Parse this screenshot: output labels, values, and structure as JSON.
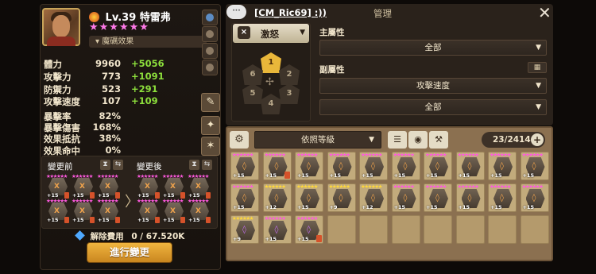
{
  "hero": {
    "level_label": "Lv.39",
    "name": "特雷弗",
    "stars": "★★★★★★",
    "effect_label": "魔礪效果"
  },
  "stats": [
    {
      "label": "體力",
      "value": "9960",
      "bonus": "+5056"
    },
    {
      "label": "攻擊力",
      "value": "773",
      "bonus": "+1091"
    },
    {
      "label": "防禦力",
      "value": "523",
      "bonus": "+291"
    },
    {
      "label": "攻擊速度",
      "value": "107",
      "bonus": "+109"
    },
    {
      "label": "暴擊率",
      "value": "82%",
      "bonus": ""
    },
    {
      "label": "暴擊傷害",
      "value": "168%",
      "bonus": ""
    },
    {
      "label": "效果抵抗",
      "value": "38%",
      "bonus": ""
    },
    {
      "label": "效果命中",
      "value": "0%",
      "bonus": ""
    }
  ],
  "change": {
    "before_label": "變更前",
    "after_label": "變更後",
    "hourglass": "⧗",
    "swap": "⇆",
    "arrow": "〉",
    "cost_label": "解除費用",
    "cost_value": "0 / 67.520K",
    "execute_label": "進行變更",
    "before_runes": [
      {
        "stars": "★★★★★★",
        "level": "+15",
        "glyph": "X",
        "star_color": "#ff5adf"
      },
      {
        "stars": "★★★★★★",
        "level": "+15",
        "glyph": "X",
        "star_color": "#ff5adf"
      },
      {
        "stars": "★★★★★★",
        "level": "+15",
        "glyph": "X",
        "star_color": "#ff5adf"
      },
      {
        "stars": "★★★★★★",
        "level": "+15",
        "glyph": "X",
        "star_color": "#ff5adf"
      },
      {
        "stars": "★★★★★★",
        "level": "+15",
        "glyph": "X",
        "star_color": "#ff5adf"
      },
      {
        "stars": "★★★★★★",
        "level": "+15",
        "glyph": "X",
        "star_color": "#ff5adf"
      }
    ],
    "after_runes": [
      {
        "stars": "★★★★★★",
        "level": "+15",
        "glyph": "X",
        "star_color": "#ff5adf"
      },
      {
        "stars": "★★★★★★",
        "level": "+15",
        "glyph": "X",
        "star_color": "#ff5adf"
      },
      {
        "stars": "★★★★★★",
        "level": "+15",
        "glyph": "X",
        "star_color": "#ff5adf"
      },
      {
        "stars": "★★★★★★",
        "level": "+15",
        "glyph": "X",
        "star_color": "#ff5adf"
      },
      {
        "stars": "★★★★★★",
        "level": "+15",
        "glyph": "X",
        "star_color": "#ff5adf"
      },
      {
        "stars": "★★★★★★",
        "level": "+15",
        "glyph": "X",
        "star_color": "#ff5adf"
      }
    ]
  },
  "manage": {
    "chat_label": "···",
    "username": "[CM_Ric69] :))",
    "title": "管理",
    "close": "✕",
    "rune_set": "激怒",
    "slots": [
      "1",
      "2",
      "3",
      "4",
      "5",
      "6"
    ],
    "main_attr_label": "主屬性",
    "main_attr_value": "全部",
    "sub_attr_label": "副屬性",
    "sub_attr_value": "攻擊速度",
    "sub_attr_value2": "全部",
    "dropdown_arrow": "▼"
  },
  "inventory": {
    "sort_label": "依照等級",
    "count": "23/2414",
    "plus": "+",
    "gear": "⚙",
    "runes": [
      {
        "stars": "★★★★★★",
        "level": "+15",
        "glyph": "◊",
        "star_color": "#ff5adf",
        "glyph_color": "#f0a34c",
        "mono": false
      },
      {
        "stars": "★★★★★★",
        "level": "+15",
        "glyph": "◊",
        "star_color": "#ff5adf",
        "glyph_color": "#f0a34c",
        "mono": true
      },
      {
        "stars": "★★★★★★",
        "level": "+15",
        "glyph": "◊",
        "star_color": "#ff5adf",
        "glyph_color": "#f0a34c",
        "mono": false
      },
      {
        "stars": "★★★★★★",
        "level": "+15",
        "glyph": "◊",
        "star_color": "#ff5adf",
        "glyph_color": "#f0a34c",
        "mono": false
      },
      {
        "stars": "★★★★★★",
        "level": "+15",
        "glyph": "◊",
        "star_color": "#ff5adf",
        "glyph_color": "#f0a34c",
        "mono": false
      },
      {
        "stars": "★★★★★★",
        "level": "+15",
        "glyph": "◊",
        "star_color": "#ff5adf",
        "glyph_color": "#f0a34c",
        "mono": false
      },
      {
        "stars": "★★★★★★",
        "level": "+15",
        "glyph": "◊",
        "star_color": "#ff5adf",
        "glyph_color": "#f0a34c",
        "mono": false
      },
      {
        "stars": "★★★★★★",
        "level": "+15",
        "glyph": "◊",
        "star_color": "#ff5adf",
        "glyph_color": "#f0a34c",
        "mono": false
      },
      {
        "stars": "★★★★★★",
        "level": "+15",
        "glyph": "◊",
        "star_color": "#ff5adf",
        "glyph_color": "#f0a34c",
        "mono": false
      },
      {
        "stars": "★★★★★★",
        "level": "+15",
        "glyph": "◊",
        "star_color": "#ff5adf",
        "glyph_color": "#f0a34c",
        "mono": false
      },
      {
        "stars": "★★★★★★",
        "level": "+15",
        "glyph": "◊",
        "star_color": "#ff5adf",
        "glyph_color": "#f0a34c",
        "mono": false
      },
      {
        "stars": "★★★★★★",
        "level": "+12",
        "glyph": "◊",
        "star_color": "#ffd83a",
        "glyph_color": "#f0a34c",
        "mono": false
      },
      {
        "stars": "★★★★★★",
        "level": "+15",
        "glyph": "◊",
        "star_color": "#ffd83a",
        "glyph_color": "#f0a34c",
        "mono": false
      },
      {
        "stars": "★★★★★★",
        "level": "+9",
        "glyph": "◊",
        "star_color": "#ffd83a",
        "glyph_color": "#f0a34c",
        "mono": false
      },
      {
        "stars": "★★★★★★",
        "level": "+12",
        "glyph": "◊",
        "star_color": "#ffd83a",
        "glyph_color": "#f0a34c",
        "mono": false
      },
      {
        "stars": "★★★★★★",
        "level": "+15",
        "glyph": "◊",
        "star_color": "#ff5adf",
        "glyph_color": "#f0a34c",
        "mono": false
      },
      {
        "stars": "★★★★★★",
        "level": "+15",
        "glyph": "◊",
        "star_color": "#ff5adf",
        "glyph_color": "#f0a34c",
        "mono": false
      },
      {
        "stars": "★★★★★★",
        "level": "+15",
        "glyph": "◊",
        "star_color": "#ff5adf",
        "glyph_color": "#f0a34c",
        "mono": false
      },
      {
        "stars": "★★★★★★",
        "level": "+15",
        "glyph": "◊",
        "star_color": "#ff5adf",
        "glyph_color": "#f0a34c",
        "mono": false
      },
      {
        "stars": "★★★★★★",
        "level": "+15",
        "glyph": "◊",
        "star_color": "#ff5adf",
        "glyph_color": "#f0a34c",
        "mono": false
      },
      {
        "stars": "★★★★★★",
        "level": "+9",
        "glyph": "◊",
        "star_color": "#ffd83a",
        "glyph_color": "#c06cf0",
        "mono": false
      },
      {
        "stars": "★★★★★★",
        "level": "+15",
        "glyph": "◊",
        "star_color": "#ff5adf",
        "glyph_color": "#c06cf0",
        "mono": false
      },
      {
        "stars": "★★★★★★",
        "level": "+15",
        "glyph": "◊",
        "star_color": "#ff5adf",
        "glyph_color": "#c06cf0",
        "mono": true
      }
    ],
    "empty_slots": 7
  }
}
